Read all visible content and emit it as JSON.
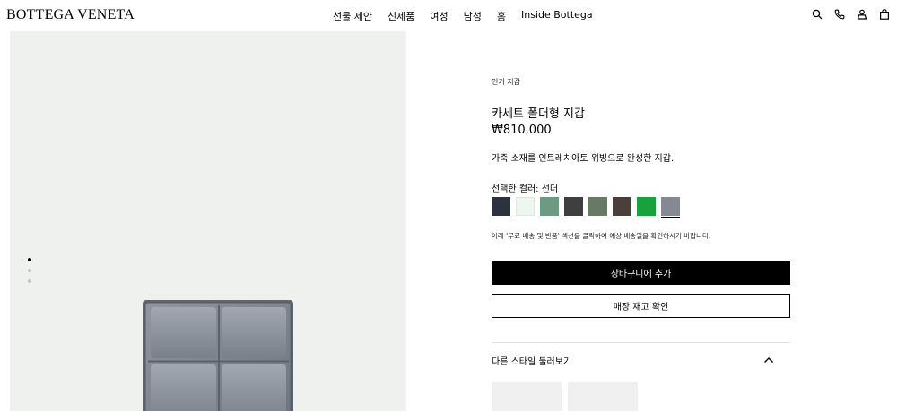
{
  "header": {
    "logo": "BOTTEGA VENETA",
    "nav": [
      "선물 제안",
      "신제품",
      "여성",
      "남성",
      "홈",
      "Inside Bottega"
    ],
    "icons": [
      "search-icon",
      "phone-icon",
      "account-icon",
      "bag-icon"
    ]
  },
  "gallery": {
    "dots": 3,
    "active_dot": 0,
    "wallet_color": "#7d838d"
  },
  "product": {
    "breadcrumb": "인기 지갑",
    "title": "카세트 폴더형 지갑",
    "price": "₩810,000",
    "description": "가죽 소재를 인트레치아토 위빙으로 완성한 지갑.",
    "color_label": "선택한 컬러: 선더",
    "swatches": [
      {
        "color": "#2c333e",
        "selected": false
      },
      {
        "color": "#eef6ef",
        "selected": false
      },
      {
        "color": "#6d9a82",
        "selected": false
      },
      {
        "color": "#3f3f3f",
        "selected": false
      },
      {
        "color": "#687a63",
        "selected": false
      },
      {
        "color": "#4b3f3c",
        "selected": false
      },
      {
        "color": "#17a23c",
        "selected": false
      },
      {
        "color": "#858993",
        "selected": true
      }
    ],
    "shipping_note": "아래 '무료 배송 및 반품' 섹션을 클릭하여 예상 배송일을 확인하시기 바랍니다.",
    "add_to_cart": "장바구니에 추가",
    "check_store": "매장 재고 확인",
    "other_styles": "다른 스타일 둘러보기"
  }
}
